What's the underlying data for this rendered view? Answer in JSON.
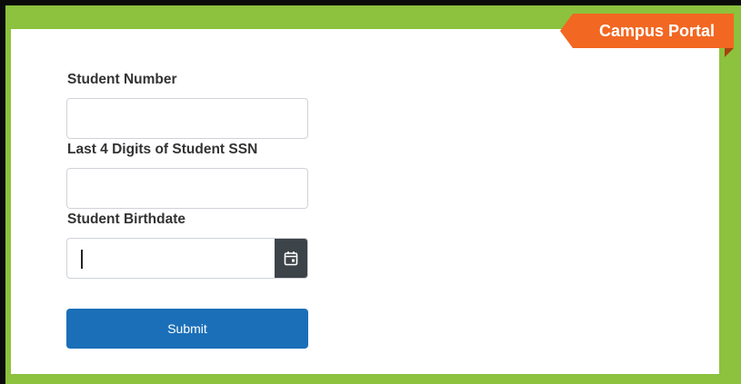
{
  "brand": {
    "ribbon_label": "Campus Portal"
  },
  "form": {
    "student_number": {
      "label": "Student Number",
      "value": "",
      "placeholder": ""
    },
    "ssn_last4": {
      "label": "Last 4 Digits of Student SSN",
      "value": "",
      "placeholder": ""
    },
    "birthdate": {
      "label": "Student Birthdate",
      "value": "",
      "placeholder": "",
      "icon": "calendar-icon"
    },
    "submit_label": "Submit"
  },
  "colors": {
    "frame_green": "#8cc23d",
    "ribbon_orange": "#f26722",
    "submit_blue": "#1b6fb8",
    "calendar_button": "#3d4449"
  }
}
